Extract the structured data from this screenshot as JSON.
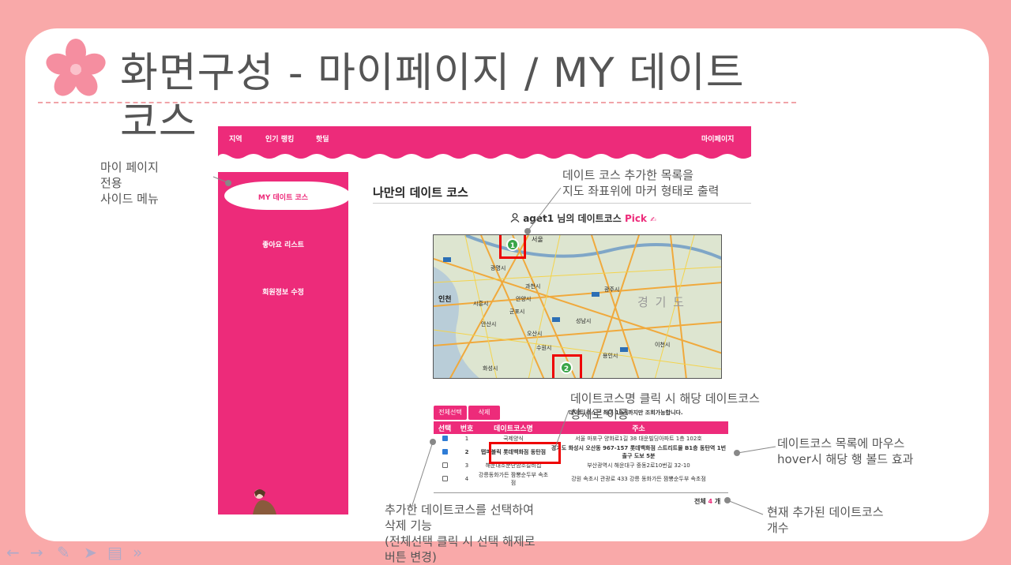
{
  "slide": {
    "title": "화면구성 -  마이페이지 / MY 데이트 코스"
  },
  "screenshot": {
    "topnav": {
      "items": [
        "지역",
        "인기 랭킹",
        "핫딜"
      ],
      "mypage": "마이페이지"
    },
    "sidebar": {
      "items": [
        "MY 데이트 코스",
        "좋아요 리스트",
        "회원정보 수정"
      ]
    },
    "heading": "나만의 데이트 코스",
    "user_line": {
      "user": "aget1 님의 데이트코스",
      "pick": "Pick"
    },
    "map": {
      "labels": [
        "서울",
        "광명시",
        "과천시",
        "인천",
        "시흥시",
        "안양시",
        "군포시",
        "안산시",
        "수원시",
        "화성시",
        "용인시",
        "광주시",
        "성남시",
        "이천시",
        "경 기 도",
        "오산시"
      ],
      "markers": [
        "1",
        "2"
      ]
    },
    "buttons": {
      "select_all": "전체선택",
      "delete": "삭제"
    },
    "note": "데이트 코스는 최대 10개까지만 조회가능합니다.",
    "table": {
      "headers": [
        "선택",
        "번호",
        "데이트코스명",
        "주소"
      ],
      "rows": [
        {
          "checked": true,
          "no": "1",
          "name": "국제양식",
          "addr": "서울 마포구 양화로1길 38 대운빌딩아파트 1층 102호",
          "bold": false
        },
        {
          "checked": true,
          "no": "2",
          "name": "탭퍼블릭 롯데백화점 동탄점",
          "addr": "경기도 화성시 오산동 967-157 롯데백화점 스트리트몰 B1층 동탄역 1번 출구 도보 5분",
          "bold": true
        },
        {
          "checked": false,
          "no": "3",
          "name": "해운대소문난암소갈비집",
          "addr": "부산광역시 해운대구 중동2로10번길 32-10",
          "bold": false
        },
        {
          "checked": false,
          "no": "4",
          "name": "강릉동화가든 짬뽕순두부 속초점",
          "addr": "강원 속초시 관광로 433 강릉 동화가든 짬뽕순두부 속초점",
          "bold": false
        }
      ],
      "total_prefix": "전체",
      "total_count": "4",
      "total_suffix": "개"
    }
  },
  "annotations": {
    "sidebar_note": "마이 페이지\n전용\n사이드 메뉴",
    "map_note": "데이트 코스 추가한 목록을\n지도 좌표위에 마커 형태로 출력",
    "click_note": "데이트코스명 클릭 시 해당 데이트코스\n상세로 이동",
    "hover_note": "데이트코스 목록에 마우스\nhover시 해당 행 볼드 효과",
    "delete_note": "추가한 데이트코스를 선택하여\n삭제 기능\n(전체선택 클릭 시 선택 해제로\n버튼 변경)",
    "count_note": "현재 추가된 데이트코스\n개수"
  },
  "colors": {
    "background": "#f9a9a9",
    "brand": "#ed2b7a",
    "highlight": "#e00000",
    "marker": "#3aa548"
  },
  "icons": [
    "flower-icon",
    "arrow-left-icon",
    "arrow-right-icon",
    "pen-icon",
    "pointer-icon",
    "slides-icon",
    "more-icon",
    "user-icon",
    "pick-icon"
  ]
}
